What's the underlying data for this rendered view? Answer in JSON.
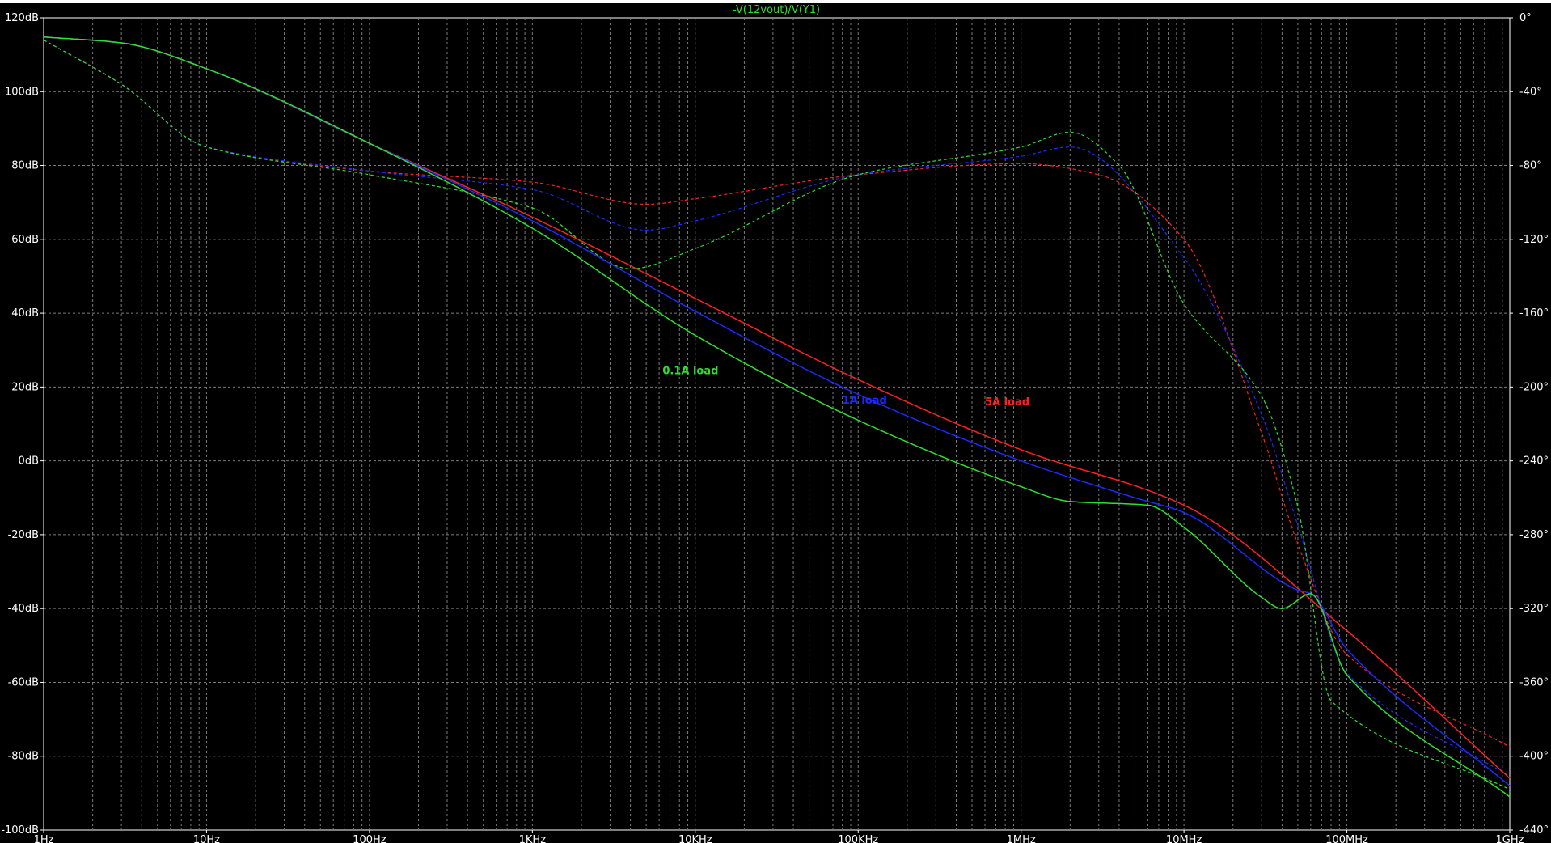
{
  "chart_data": {
    "type": "line",
    "title": "-V(12vout)/V(Y1)",
    "x_scale": "log",
    "xlim": [
      1,
      1000000000
    ],
    "x_ticks": [
      {
        "value": 1,
        "label": "1Hz"
      },
      {
        "value": 10,
        "label": "10Hz"
      },
      {
        "value": 100,
        "label": "100Hz"
      },
      {
        "value": 1000,
        "label": "1KHz"
      },
      {
        "value": 10000,
        "label": "10KHz"
      },
      {
        "value": 100000,
        "label": "100KHz"
      },
      {
        "value": 1000000,
        "label": "1MHz"
      },
      {
        "value": 10000000,
        "label": "10MHz"
      },
      {
        "value": 100000000,
        "label": "100MHz"
      },
      {
        "value": 1000000000,
        "label": "1GHz"
      }
    ],
    "ylim_left": [
      -100,
      120
    ],
    "y_left_ticks": [
      {
        "value": 120,
        "label": "120dB"
      },
      {
        "value": 100,
        "label": "100dB"
      },
      {
        "value": 80,
        "label": "80dB"
      },
      {
        "value": 60,
        "label": "60dB"
      },
      {
        "value": 40,
        "label": "40dB"
      },
      {
        "value": 20,
        "label": "20dB"
      },
      {
        "value": 0,
        "label": "0dB"
      },
      {
        "value": -20,
        "label": "-20dB"
      },
      {
        "value": -40,
        "label": "-40dB"
      },
      {
        "value": -60,
        "label": "-60dB"
      },
      {
        "value": -80,
        "label": "-80dB"
      },
      {
        "value": -100,
        "label": "-100dB"
      }
    ],
    "ylim_right": [
      -440,
      0
    ],
    "y_right_ticks": [
      {
        "value": 0,
        "label": "0°"
      },
      {
        "value": -40,
        "label": "-40°"
      },
      {
        "value": -80,
        "label": "-80°"
      },
      {
        "value": -120,
        "label": "-120°"
      },
      {
        "value": -160,
        "label": "-160°"
      },
      {
        "value": -200,
        "label": "-200°"
      },
      {
        "value": -240,
        "label": "-240°"
      },
      {
        "value": -280,
        "label": "-280°"
      },
      {
        "value": -320,
        "label": "-320°"
      },
      {
        "value": -360,
        "label": "-360°"
      },
      {
        "value": -400,
        "label": "-400°"
      },
      {
        "value": -440,
        "label": "-440°"
      }
    ],
    "grid": true,
    "magnitude_series": [
      {
        "name": "5A load",
        "color": "#ff2020",
        "points": [
          [
            1,
            114.8
          ],
          [
            3,
            113.2
          ],
          [
            10,
            106.2
          ],
          [
            100,
            86
          ],
          [
            1000,
            66
          ],
          [
            10000,
            44
          ],
          [
            100000,
            22
          ],
          [
            1000000,
            3
          ],
          [
            10000000,
            -12
          ],
          [
            100000000,
            -46
          ],
          [
            1000000000,
            -86
          ]
        ]
      },
      {
        "name": "1A load",
        "color": "#1a2bff",
        "points": [
          [
            1,
            114.8
          ],
          [
            3,
            113.2
          ],
          [
            10,
            106.2
          ],
          [
            100,
            86
          ],
          [
            1000,
            65
          ],
          [
            10000,
            40.5
          ],
          [
            100000,
            18
          ],
          [
            1000000,
            0
          ],
          [
            5000000,
            -10
          ],
          [
            10000000,
            -14
          ],
          [
            50000000,
            -35
          ],
          [
            60000000,
            -36
          ],
          [
            100000000,
            -51
          ],
          [
            1000000000,
            -88
          ]
        ]
      },
      {
        "name": "0.1A load",
        "color": "#2ee02e",
        "points": [
          [
            1,
            114.8
          ],
          [
            3,
            113.2
          ],
          [
            10,
            106.2
          ],
          [
            100,
            86
          ],
          [
            1000,
            63
          ],
          [
            10000,
            34
          ],
          [
            100000,
            11
          ],
          [
            1000000,
            -7
          ],
          [
            2000000,
            -11
          ],
          [
            6000000,
            -12
          ],
          [
            10000000,
            -18
          ],
          [
            30000000,
            -37
          ],
          [
            40000000,
            -40
          ],
          [
            60000000,
            -36
          ],
          [
            100000000,
            -58
          ],
          [
            1000000000,
            -91
          ]
        ]
      }
    ],
    "phase_series": [
      {
        "name": "5A load",
        "color": "#ff2020",
        "points": [
          [
            1,
            -12
          ],
          [
            3,
            -36
          ],
          [
            10,
            -70
          ],
          [
            100,
            -83
          ],
          [
            1000,
            -89
          ],
          [
            5000,
            -101
          ],
          [
            10000,
            -98
          ],
          [
            100000,
            -85
          ],
          [
            1000000,
            -79
          ],
          [
            3000000,
            -85
          ],
          [
            10000000,
            -120
          ],
          [
            30000000,
            -225
          ],
          [
            50000000,
            -285
          ],
          [
            100000000,
            -345
          ],
          [
            1000000000,
            -395
          ]
        ]
      },
      {
        "name": "1A load",
        "color": "#1a2bff",
        "points": [
          [
            1,
            -12
          ],
          [
            3,
            -36
          ],
          [
            10,
            -70
          ],
          [
            100,
            -83
          ],
          [
            1000,
            -93
          ],
          [
            5000,
            -115
          ],
          [
            10000,
            -110
          ],
          [
            100000,
            -85
          ],
          [
            1000000,
            -75
          ],
          [
            2000000,
            -70
          ],
          [
            10000000,
            -130
          ],
          [
            30000000,
            -215
          ],
          [
            50000000,
            -275
          ],
          [
            100000000,
            -355
          ],
          [
            1000000000,
            -411
          ]
        ]
      },
      {
        "name": "0.1A load",
        "color": "#2ee02e",
        "points": [
          [
            1,
            -12
          ],
          [
            3,
            -36
          ],
          [
            10,
            -70
          ],
          [
            100,
            -85
          ],
          [
            1000,
            -103
          ],
          [
            4000,
            -136
          ],
          [
            10000,
            -125
          ],
          [
            100000,
            -85
          ],
          [
            1000000,
            -70
          ],
          [
            2000000,
            -62
          ],
          [
            4000000,
            -80
          ],
          [
            10000000,
            -155
          ],
          [
            30000000,
            -205
          ],
          [
            50000000,
            -265
          ],
          [
            80000000,
            -370
          ],
          [
            1000000000,
            -418
          ]
        ]
      }
    ],
    "annotations": [
      {
        "text": "0.1A load",
        "color": "#2ee02e",
        "x": 6300,
        "y": 23.5
      },
      {
        "text": "1A load",
        "color": "#1a2bff",
        "x": 80000,
        "y": 15.5
      },
      {
        "text": "5A load",
        "color": "#ff2020",
        "x": 600000,
        "y": 15
      }
    ]
  }
}
